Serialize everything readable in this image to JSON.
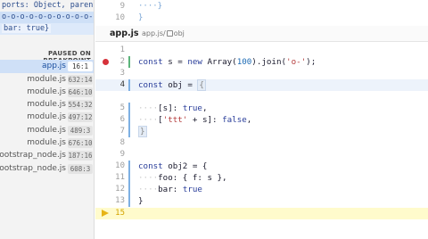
{
  "variables": {
    "line1": "ports: Object, parent: n…",
    "line2": "o-o-o-o-o-o-o-o-o-o-o-o-o-…",
    "line3": "bar: true}"
  },
  "paused_header": "PAUSED ON BREAKPOINT",
  "call_stack": [
    {
      "name": "app.js",
      "loc": "16:1",
      "selected": true
    },
    {
      "name": "module.js",
      "loc": "632:14",
      "selected": false
    },
    {
      "name": "module.js",
      "loc": "646:10",
      "selected": false
    },
    {
      "name": "module.js",
      "loc": "554:32",
      "selected": false
    },
    {
      "name": "module.js",
      "loc": "497:12",
      "selected": false
    },
    {
      "name": "module.js",
      "loc": "489:3",
      "selected": false
    },
    {
      "name": "module.js",
      "loc": "676:10",
      "selected": false
    },
    {
      "name": "bootstrap_node.js",
      "loc": "187:16",
      "selected": false
    },
    {
      "name": "bootstrap_node.js",
      "loc": "608:3",
      "selected": false
    }
  ],
  "top_snippet": {
    "lines": [
      {
        "num": "9",
        "code": "····}"
      },
      {
        "num": "10",
        "code": "}"
      }
    ]
  },
  "tab": {
    "file": "app.js",
    "crumb_file": "app.js/",
    "crumb_obj": "obj"
  },
  "editor": {
    "lines": [
      {
        "num": "1"
      },
      {
        "num": "2"
      },
      {
        "num": "3"
      },
      {
        "num": "4"
      },
      {
        "num": "5"
      },
      {
        "num": "6"
      },
      {
        "num": "7"
      },
      {
        "num": "8"
      },
      {
        "num": "9"
      },
      {
        "num": "10"
      },
      {
        "num": "11"
      },
      {
        "num": "12"
      },
      {
        "num": "13"
      },
      {
        "num": "14"
      },
      {
        "num": "15"
      }
    ],
    "code": {
      "l2_kw": "const",
      "l2_a": " s = ",
      "l2_kw2": "new",
      "l2_b": " Array(",
      "l2_num": "100",
      "l2_c": ").join(",
      "l2_str": "'o-'",
      "l2_d": ");",
      "l4_kw": "const",
      "l4_a": " obj = ",
      "l4_brace": "{",
      "l5_dots": "····",
      "l5_a": "[s]: ",
      "l5_kw": "true",
      "l5_b": ",",
      "l6_dots": "····",
      "l6_a": "[",
      "l6_str": "'ttt'",
      "l6_b": " + s]: ",
      "l6_kw": "false",
      "l6_c": ",",
      "l7_brace": "}",
      "l10_kw": "const",
      "l10_a": " obj2 = {",
      "l11_dots": "····",
      "l11_a": "foo: { f: s },",
      "l12_dots": "····",
      "l12_a": "bar: ",
      "l12_kw": "true",
      "l13_a": "}"
    }
  },
  "colors": {
    "breakpoint": "#d6323a",
    "paused_line": "#fffbcc",
    "current_line": "#edf3fb",
    "selected_frame": "#cfe0f7"
  }
}
